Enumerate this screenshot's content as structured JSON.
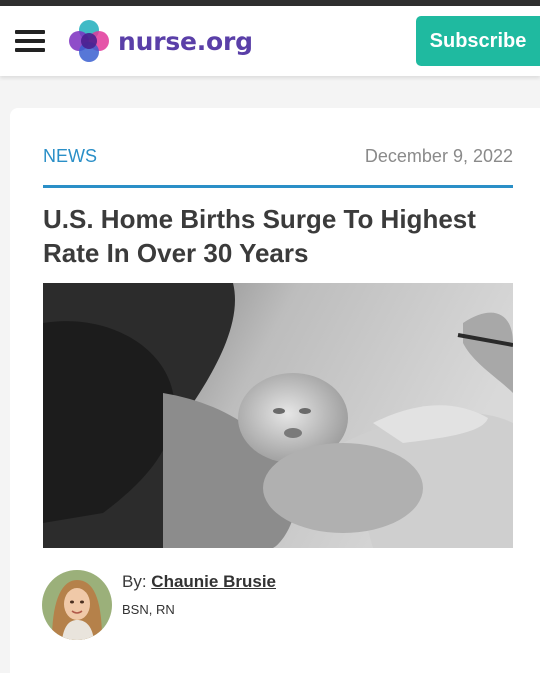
{
  "header": {
    "logo_text": "nurse.org",
    "subscribe_label": "Subscribe",
    "menu_icon": "hamburger-menu-icon",
    "logo_icon": "nurse-org-logo-icon"
  },
  "article": {
    "category": "NEWS",
    "date": "December 9, 2022",
    "title": "U.S. Home Births Surge To Highest Rate In Over 30 Years",
    "image_alt": "Newborn baby held against mother's chest (black and white photo)"
  },
  "author": {
    "by_label": "By:",
    "name": "Chaunie Brusie",
    "credentials": "BSN, RN"
  },
  "colors": {
    "brand_purple": "#5a3fa8",
    "subscribe_teal": "#1fbaa0",
    "accent_blue": "#2a8fc7"
  }
}
